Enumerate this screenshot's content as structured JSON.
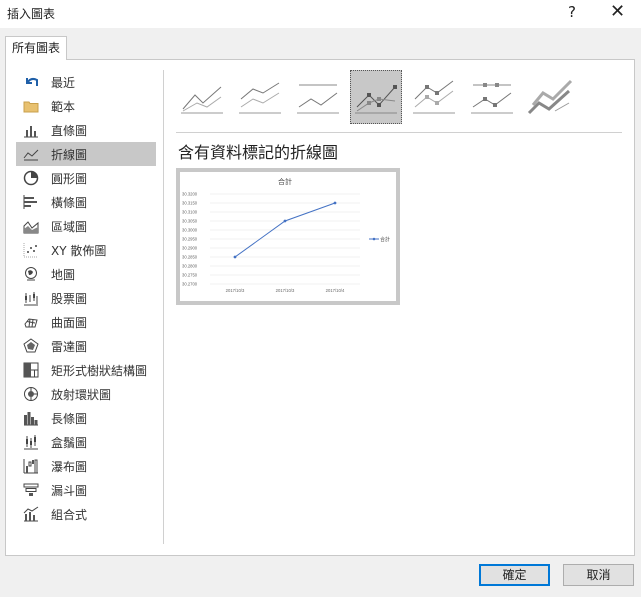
{
  "window": {
    "title": "插入圖表",
    "help": "?",
    "close": "✕"
  },
  "tab": {
    "label": "所有圖表"
  },
  "sidebar": {
    "items": [
      {
        "label": "最近",
        "icon": "undo-arrow-icon"
      },
      {
        "label": "範本",
        "icon": "folder-icon"
      },
      {
        "label": "直條圖",
        "icon": "column-chart-icon"
      },
      {
        "label": "折線圖",
        "icon": "line-chart-icon",
        "selected": true
      },
      {
        "label": "圓形圖",
        "icon": "pie-chart-icon"
      },
      {
        "label": "橫條圖",
        "icon": "bar-chart-icon"
      },
      {
        "label": "區域圖",
        "icon": "area-chart-icon"
      },
      {
        "label": "XY 散佈圖",
        "icon": "scatter-chart-icon"
      },
      {
        "label": "地圖",
        "icon": "map-globe-icon"
      },
      {
        "label": "股票圖",
        "icon": "stock-chart-icon"
      },
      {
        "label": "曲面圖",
        "icon": "surface-chart-icon"
      },
      {
        "label": "雷達圖",
        "icon": "radar-chart-icon"
      },
      {
        "label": "矩形式樹狀結構圖",
        "icon": "treemap-icon"
      },
      {
        "label": "放射環狀圖",
        "icon": "sunburst-icon"
      },
      {
        "label": "長條圖",
        "icon": "histogram-icon"
      },
      {
        "label": "盒鬚圖",
        "icon": "box-whisker-icon"
      },
      {
        "label": "瀑布圖",
        "icon": "waterfall-icon"
      },
      {
        "label": "漏斗圖",
        "icon": "funnel-icon"
      },
      {
        "label": "組合式",
        "icon": "combo-chart-icon"
      }
    ]
  },
  "subtypes": [
    {
      "name": "line-icon",
      "selected": false
    },
    {
      "name": "stacked-line-icon",
      "selected": false
    },
    {
      "name": "100-stacked-line-icon",
      "selected": false
    },
    {
      "name": "line-with-markers-icon",
      "selected": true
    },
    {
      "name": "stacked-line-with-markers-icon",
      "selected": false
    },
    {
      "name": "100-stacked-line-with-markers-icon",
      "selected": false
    },
    {
      "name": "3d-line-icon",
      "selected": false
    }
  ],
  "selected_subtype_title": "含有資料標記的折線圖",
  "preview": {
    "chart_data": {
      "type": "line",
      "title": "合計",
      "categories": [
        "2017/10/3",
        "2017/10/3",
        "2017/10/4"
      ],
      "series": [
        {
          "name": "合計",
          "values": [
            30.285,
            30.305,
            30.315
          ]
        }
      ],
      "yticks": [
        "30.3200",
        "30.3150",
        "30.3100",
        "30.3050",
        "30.3000",
        "30.2950",
        "30.2900",
        "30.2850",
        "30.2800",
        "30.2750",
        "30.2700"
      ],
      "ylim": [
        30.27,
        30.32
      ],
      "legend_position": "right",
      "color": "#4472c4"
    }
  },
  "buttons": {
    "ok": "確定",
    "cancel": "取消"
  }
}
